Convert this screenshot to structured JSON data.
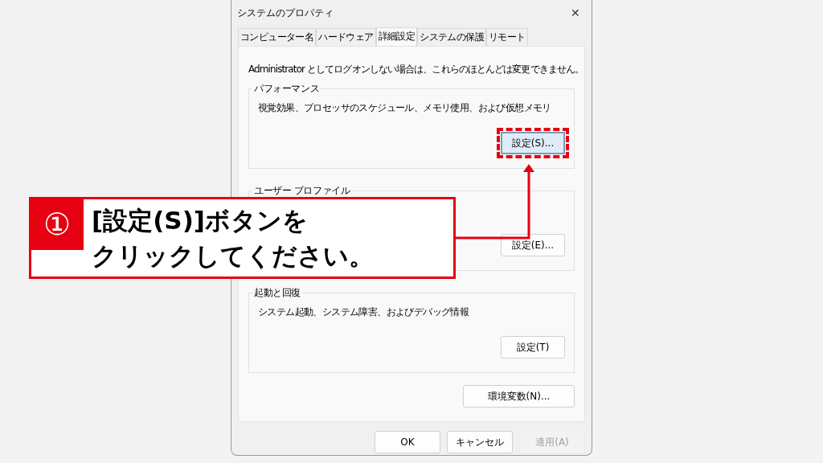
{
  "window": {
    "title": "システムのプロパティ",
    "close": "✕"
  },
  "tabs": [
    {
      "label": "コンピューター名",
      "selected": false
    },
    {
      "label": "ハードウェア",
      "selected": false
    },
    {
      "label": "詳細設定",
      "selected": true
    },
    {
      "label": "システムの保護",
      "selected": false
    },
    {
      "label": "リモート",
      "selected": false
    }
  ],
  "notice": "Administrator としてログオンしない場合は、これらのほとんどは変更できません。",
  "groups": [
    {
      "title": "パフォーマンス",
      "description": "視覚効果、プロセッサのスケジュール、メモリ使用、および仮想メモリ",
      "button": "設定(S)...",
      "highlighted": true
    },
    {
      "title": "ユーザー プロファイル",
      "button": "設定(E)...",
      "highlighted": false
    },
    {
      "title": "起動と回復",
      "description": "システム起動、システム障害、およびデバッグ情報",
      "button": "設定(T)",
      "highlighted": false
    }
  ],
  "env_button": "環境変数(N)...",
  "buttons": [
    {
      "label": "OK",
      "disabled": false
    },
    {
      "label": "キャンセル",
      "disabled": false
    },
    {
      "label": "適用(A)",
      "disabled": true
    }
  ],
  "callout": {
    "number": "①",
    "lines": [
      "[設定(S)]ボタンを",
      "クリックしてください。"
    ]
  }
}
